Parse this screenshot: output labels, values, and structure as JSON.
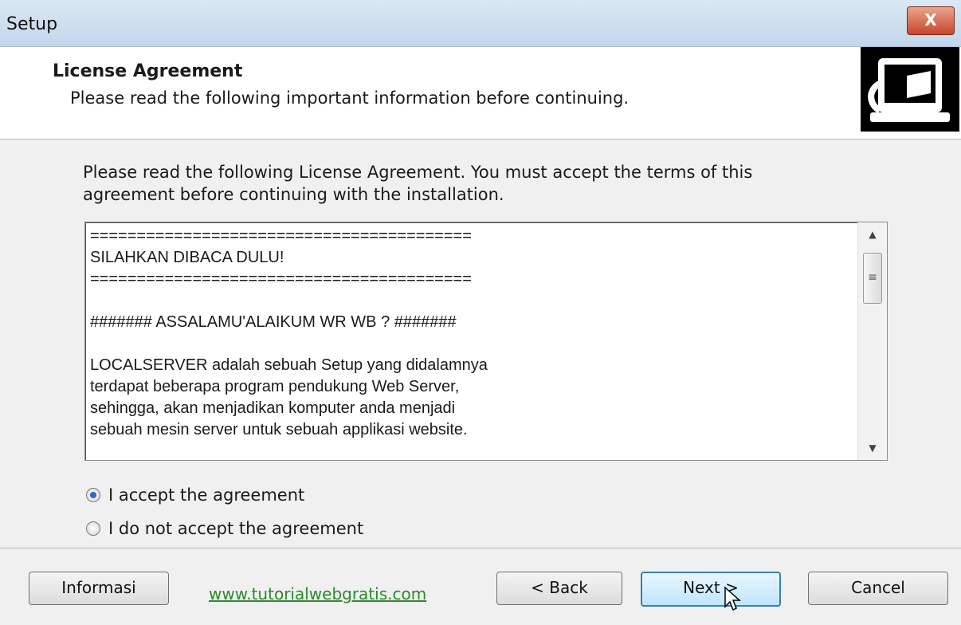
{
  "window": {
    "title": "Setup",
    "close_label": "X"
  },
  "header": {
    "title": "License Agreement",
    "subtitle": "Please read the following important information before continuing.",
    "logo_icon": "computer-setup-icon"
  },
  "main": {
    "intro": "Please read the following License Agreement. You must accept the terms of this agreement before continuing with the installation.",
    "license_text": "=========================================\nSILAHKAN DIBACA DULU!\n=========================================\n\n####### ASSALAMU'ALAIKUM WR WB ? #######\n\nLOCALSERVER adalah sebuah Setup yang didalamnya\nterdapat beberapa program pendukung Web Server,\nsehingga, akan menjadikan komputer anda menjadi\nsebuah mesin server untuk sebuah applikasi website.",
    "options": [
      {
        "label": "I accept the agreement",
        "selected": true
      },
      {
        "label": "I do not accept the agreement",
        "selected": false
      }
    ]
  },
  "footer": {
    "info_label": "Informasi",
    "link_text": "www.tutorialwebgratis.com",
    "back_label": "< Back",
    "next_label": "Next >",
    "cancel_label": "Cancel"
  },
  "colors": {
    "link": "#2a8a2a",
    "accent": "#3c7fb1",
    "close": "#c9462c"
  }
}
